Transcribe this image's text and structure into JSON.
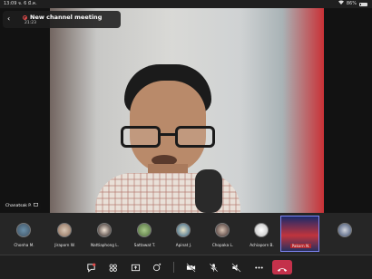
{
  "status_bar": {
    "time": "13:09",
    "date": "จ. 6 มี.ค.",
    "battery": "86%"
  },
  "meeting": {
    "title": "New channel meeting",
    "elapsed": "21:23"
  },
  "main_speaker": {
    "name": "Chanatsak P."
  },
  "participants": [
    {
      "name": "Chonha M.",
      "active": false
    },
    {
      "name": "Jiraporn W.",
      "active": false
    },
    {
      "name": "Nattiaphong L.",
      "active": false
    },
    {
      "name": "Sattawat T.",
      "active": false
    },
    {
      "name": "Apinat J.",
      "active": false
    },
    {
      "name": "Chopaka L.",
      "active": false
    },
    {
      "name": "Achiaporn B.",
      "active": false
    },
    {
      "name": "Pakorn N.",
      "active": true
    },
    {
      "name": "",
      "active": false
    }
  ],
  "toolbar": {
    "icons": [
      "chat-icon",
      "participants-icon",
      "share-icon",
      "reactions-icon",
      "camera-off-icon",
      "mic-off-icon",
      "speaker-off-icon",
      "more-icon",
      "hang-up-icon"
    ]
  },
  "colors": {
    "hangup": "#c4314b",
    "accent": "#7f85f5",
    "recording_dot": "#e04b4b"
  }
}
